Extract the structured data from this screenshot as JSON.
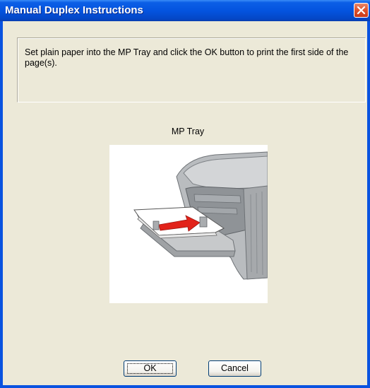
{
  "window": {
    "title": "Manual Duplex Instructions",
    "close_icon": "close-x-icon",
    "accent_color": "#0454df",
    "close_color": "#e0542e"
  },
  "message": {
    "text": "Set plain paper into the MP Tray and click the OK button to print the first side of the page(s)."
  },
  "illustration": {
    "label": "MP Tray",
    "description_icon": "printer-mp-tray-illustration"
  },
  "buttons": {
    "ok_label": "OK",
    "cancel_label": "Cancel"
  }
}
